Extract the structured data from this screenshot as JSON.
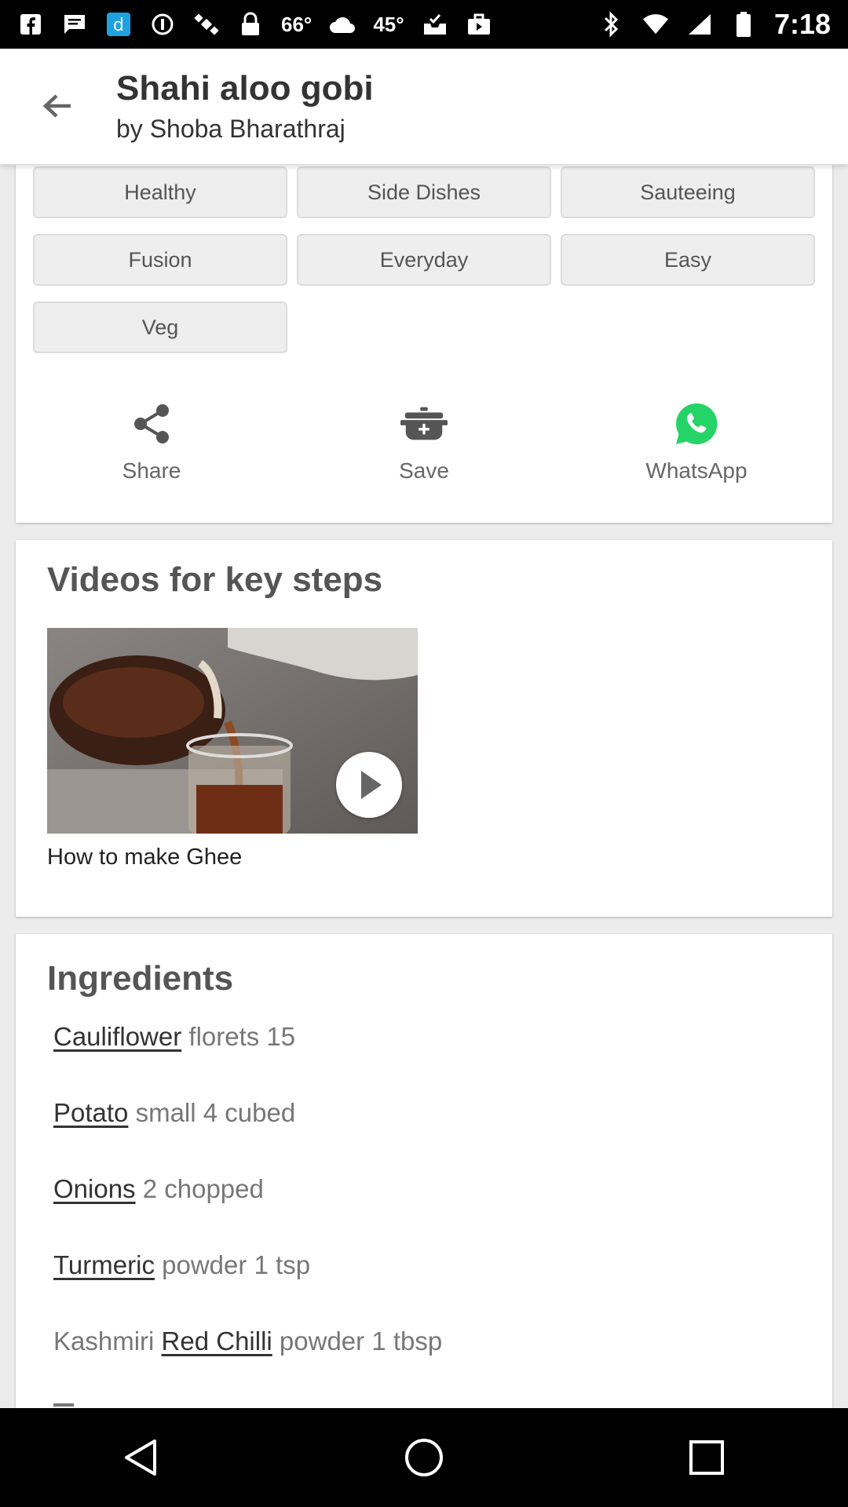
{
  "status_bar": {
    "temp1": "66°",
    "temp2": "45°",
    "time": "7:18"
  },
  "header": {
    "title": "Shahi aloo gobi",
    "subtitle": "by Shoba Bharathraj"
  },
  "tags": [
    "Healthy",
    "Side Dishes",
    "Sauteeing",
    "Fusion",
    "Everyday",
    "Easy",
    "Veg"
  ],
  "actions": {
    "share": "Share",
    "save": "Save",
    "whatsapp": "WhatsApp"
  },
  "videos": {
    "title": "Videos for key steps",
    "items": [
      {
        "caption": "How to make Ghee"
      }
    ]
  },
  "ingredients": {
    "title": "Ingredients",
    "items": [
      {
        "link": "Cauliflower",
        "rest": " florets 15"
      },
      {
        "link": "Potato",
        "rest": " small 4 cubed"
      },
      {
        "link": "Onions",
        "rest": " 2 chopped"
      },
      {
        "link": "Turmeric",
        "rest": " powder 1 tsp"
      },
      {
        "pre": "Kashmiri ",
        "link": "Red Chilli",
        "rest": " powder 1 tbsp"
      }
    ]
  },
  "colors": {
    "whatsapp": "#25D366",
    "tag_bg": "#eeeeee",
    "page_bg": "#ececec"
  }
}
